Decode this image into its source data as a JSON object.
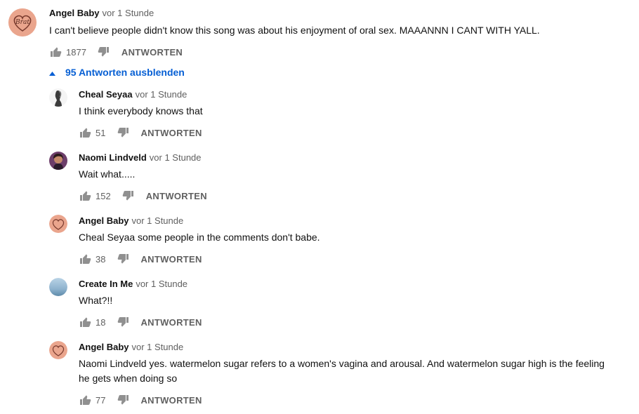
{
  "main_comment": {
    "author": "Angel Baby",
    "time": "vor 1 Stunde",
    "text": "I can't believe people didn't know this song was about his enjoyment of oral sex. MAAANNN I CANT WITH YALL.",
    "likes": "1877",
    "reply_label": "ANTWORTEN",
    "avatar_text": "Brat"
  },
  "replies_toggle": {
    "label": "95 Antworten ausblenden",
    "color": "#065fd4"
  },
  "replies": [
    {
      "author": "Cheal Seyaa",
      "time": "vor 1 Stunde",
      "text": "I think everybody knows that",
      "likes": "51",
      "reply_label": "ANTWORTEN",
      "avatar": "silhouette-avatar"
    },
    {
      "author": "Naomi Lindveld",
      "time": "vor 1 Stunde",
      "text": "Wait what.....",
      "likes": "152",
      "reply_label": "ANTWORTEN",
      "avatar": "photo-avatar"
    },
    {
      "author": "Angel Baby",
      "time": "vor 1 Stunde",
      "text": "Cheal Seyaa some people in the comments don't babe.",
      "likes": "38",
      "reply_label": "ANTWORTEN",
      "avatar": "brat-avatar"
    },
    {
      "author": "Create In Me",
      "time": "vor 1 Stunde",
      "text": "What?!!",
      "likes": "18",
      "reply_label": "ANTWORTEN",
      "avatar": "sky-avatar"
    },
    {
      "author": "Angel Baby",
      "time": "vor 1 Stunde",
      "text": "Naomi Lindveld yes. watermelon sugar refers to a women's vagina and arousal. And watermelon sugar high is the feeling he gets when doing so",
      "likes": "77",
      "reply_label": "ANTWORTEN",
      "avatar": "brat-avatar"
    }
  ]
}
